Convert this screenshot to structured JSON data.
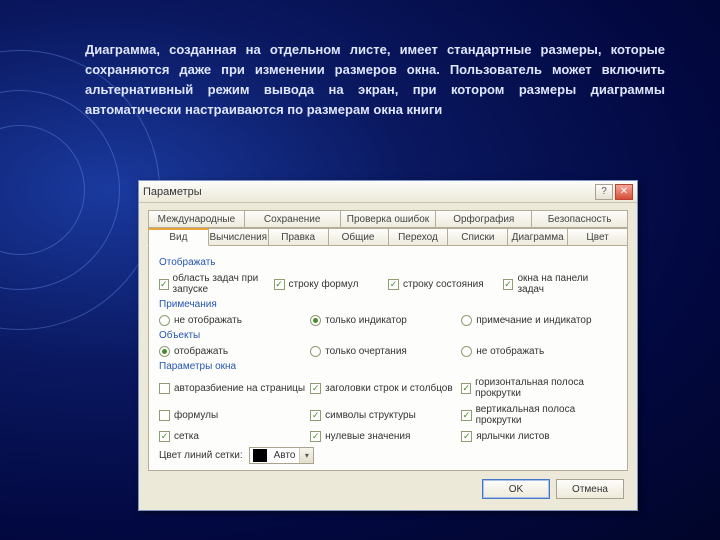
{
  "description": "Диаграмма, созданная на отдельном листе, имеет стандартные размеры, которые сохраняются даже при изменении размеров окна. Пользователь может включить альтернативный режим вывода на экран, при котором размеры диаграммы автоматически настраиваются по размерам окна книги",
  "dialog": {
    "title": "Параметры",
    "tabs_row1": [
      "Международные",
      "Сохранение",
      "Проверка ошибок",
      "Орфография",
      "Безопасность"
    ],
    "tabs_row2": [
      "Вид",
      "Вычисления",
      "Правка",
      "Общие",
      "Переход",
      "Списки",
      "Диаграмма",
      "Цвет"
    ],
    "active_tab": "Вид",
    "group_display": {
      "title": "Отображать",
      "items": [
        {
          "label": "область задач при запуске",
          "checked": true
        },
        {
          "label": "строку формул",
          "checked": true
        },
        {
          "label": "строку состояния",
          "checked": true
        },
        {
          "label": "окна на панели задач",
          "checked": true
        }
      ]
    },
    "group_comments": {
      "title": "Примечания",
      "items": [
        {
          "label": "не отображать",
          "checked": false
        },
        {
          "label": "только индикатор",
          "checked": true
        },
        {
          "label": "примечание и индикатор",
          "checked": false
        }
      ]
    },
    "group_objects": {
      "title": "Объекты",
      "items": [
        {
          "label": "отображать",
          "checked": true
        },
        {
          "label": "только очертания",
          "checked": false
        },
        {
          "label": "не отображать",
          "checked": false
        }
      ]
    },
    "group_window": {
      "title": "Параметры окна",
      "items": [
        {
          "label": "авторазбиение на страницы",
          "checked": false
        },
        {
          "label": "заголовки строк и столбцов",
          "checked": true
        },
        {
          "label": "горизонтальная полоса прокрутки",
          "checked": true
        },
        {
          "label": "формулы",
          "checked": false
        },
        {
          "label": "символы структуры",
          "checked": true
        },
        {
          "label": "вертикальная полоса прокрутки",
          "checked": true
        },
        {
          "label": "сетка",
          "checked": true
        },
        {
          "label": "нулевые значения",
          "checked": true
        },
        {
          "label": "ярлычки листов",
          "checked": true
        }
      ]
    },
    "grid_color": {
      "label": "Цвет линий сетки:",
      "value": "Авто"
    },
    "buttons": {
      "ok": "OK",
      "cancel": "Отмена"
    }
  }
}
